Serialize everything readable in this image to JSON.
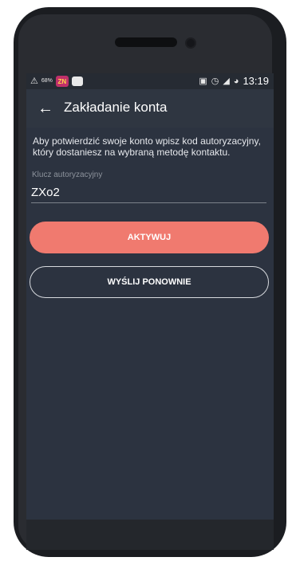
{
  "status_bar": {
    "battery_percent": "68%",
    "time": "13:19",
    "icons": [
      "usb-debug-icon",
      "app-badge-icon",
      "cat-app-icon",
      "cast-icon",
      "alarm-icon",
      "lte-signal-icon",
      "sync-icon"
    ]
  },
  "toolbar": {
    "title": "Zakładanie konta",
    "back_icon": "arrow-left-icon"
  },
  "content": {
    "info_text": "Aby potwierdzić swoje konto wpisz kod autoryzacyjny, który dostaniesz na wybraną metodę kontaktu.",
    "auth_field": {
      "label": "Klucz autoryzacyjny",
      "value": "ZXo2"
    },
    "activate_button": "AKTYWUJ",
    "resend_button": "WYŚLIJ PONOWNIE"
  },
  "colors": {
    "background": "#2c3340",
    "toolbar": "#2f3641",
    "primary_button": "#f07a6f",
    "outline": "#d7dade"
  }
}
